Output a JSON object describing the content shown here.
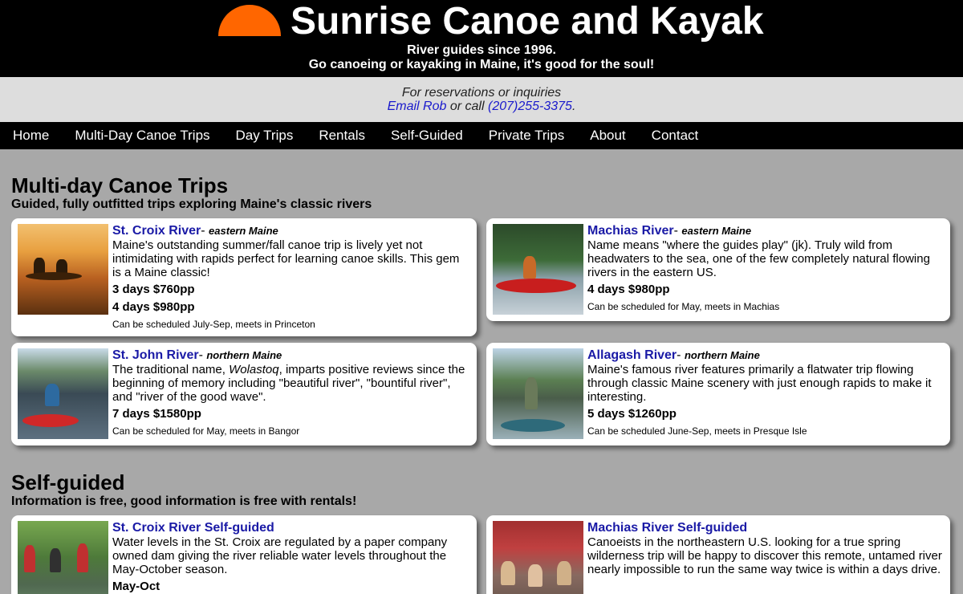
{
  "site": {
    "title": "Sunrise Canoe and Kayak",
    "tagline1": "River guides since 1996.",
    "tagline2": "Go canoeing or kayaking in Maine, it's good for the soul!"
  },
  "contact": {
    "line1": "For reservations or inquiries",
    "email_link": "Email Rob",
    "or_call": " or call ",
    "phone": "(207)255-3375",
    "period": "."
  },
  "nav": [
    "Home",
    "Multi-Day Canoe Trips",
    "Day Trips",
    "Rentals",
    "Self-Guided",
    "Private Trips",
    "About",
    "Contact"
  ],
  "multiday": {
    "title": "Multi-day Canoe Trips",
    "subtitle": "Guided, fully outfitted trips exploring Maine's classic rivers",
    "cards": [
      {
        "name": "St. Croix River",
        "region": "eastern Maine",
        "desc": "Maine's outstanding summer/fall canoe trip is lively yet not intimidating with rapids perfect for learning canoe skills. This gem is a Maine classic!",
        "price1": "3 days $760pp",
        "price2": "4 days $980pp",
        "schedule": "Can be scheduled July-Sep, meets in Princeton"
      },
      {
        "name": "Machias River",
        "region": "eastern Maine",
        "desc": "Name means \"where the guides play\" (jk). Truly wild from headwaters to the sea, one of the few completely natural flowing rivers in the eastern US.",
        "price1": "4 days $980pp",
        "schedule": "Can be scheduled for May, meets in Machias"
      },
      {
        "name": "St. John River",
        "region": "northern Maine",
        "desc_pre": "The traditional name, ",
        "desc_em": "Wolastoq",
        "desc_post": ", imparts positive reviews since the beginning of memory including \"beautiful river\", \"bountiful river\", and \"river of the good wave\".",
        "price1": "7 days $1580pp",
        "schedule": "Can be scheduled for May, meets in Bangor"
      },
      {
        "name": "Allagash River",
        "region": "northern Maine",
        "desc": "Maine's famous river features primarily a flatwater trip flowing through classic Maine scenery with just enough rapids to make it interesting.",
        "price1": "5 days $1260pp",
        "schedule": "Can be scheduled June-Sep, meets in Presque Isle"
      }
    ]
  },
  "selfguided": {
    "title": "Self-guided",
    "subtitle": "Information is free, good information is free with rentals!",
    "cards": [
      {
        "name": "St. Croix River Self-guided",
        "desc": "Water levels in the St. Croix are regulated by a paper company owned dam giving the river reliable water levels throughout the May-October season.",
        "price1": "May-Oct"
      },
      {
        "name": "Machias River Self-guided",
        "desc": "Canoeists in the northeastern U.S. looking for a true spring wilderness trip will be happy to discover this remote, untamed river nearly impossible to run the same way twice is within a days drive."
      }
    ]
  },
  "colors": {
    "sun": "#ff6600",
    "link": "#1a1aa6",
    "background": "#a8a8a8"
  }
}
